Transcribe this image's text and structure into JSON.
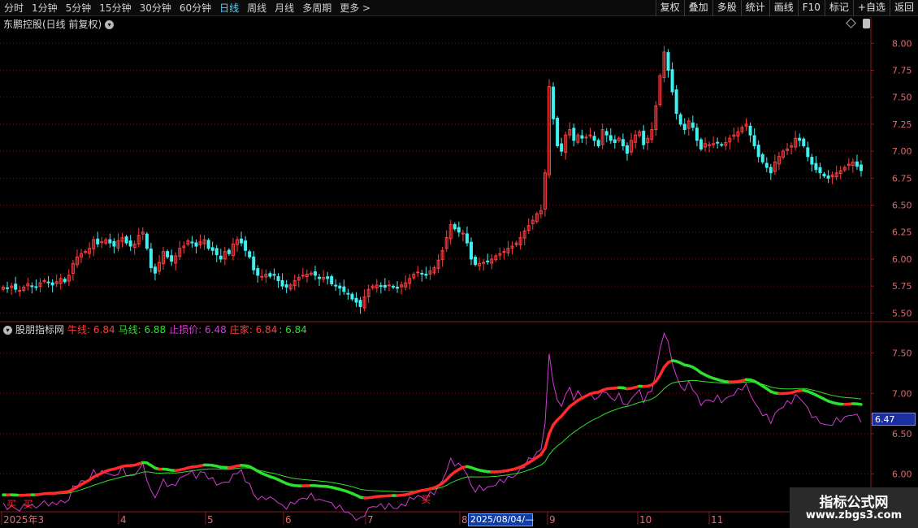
{
  "toolbar": {
    "periods": [
      "分时",
      "1分钟",
      "5分钟",
      "15分钟",
      "30分钟",
      "60分钟",
      "日线",
      "周线",
      "月线",
      "多周期",
      "更多 >"
    ],
    "active_period": "日线",
    "tools": [
      "复权",
      "叠加",
      "多股",
      "统计",
      "画线",
      "F10",
      "标记",
      "+自选",
      "返回"
    ]
  },
  "price_panel": {
    "title": "东鹏控股(日线 前复权)"
  },
  "indicator_panel": {
    "name": "股朋指标网",
    "bull_label": "牛线: 6.84",
    "horse_label": "马线: 6.88",
    "stop_label": "止损价: 6.48",
    "dealer_label": "庄家: 6.84",
    "dealer_extra": ": 6.84",
    "value_badge": "6.47",
    "marker_char": "买"
  },
  "x_axis": {
    "labels": [
      "2025年3",
      "4",
      "5",
      "6",
      "7",
      "8",
      "9",
      "10",
      "11"
    ],
    "cursor_date": "2025/08/04/—"
  },
  "watermark": {
    "title": "指标公式网",
    "url": "www.zbgs3.com"
  },
  "colors": {
    "up": "#ff3c3c",
    "down": "#3ef0f0",
    "bull_line": "#ff2a2a",
    "horse_line": "#2ee02e",
    "stop_line": "#d23cd2",
    "axis_text": "#e06a6a",
    "grid": "#6a1515"
  },
  "chart_data": [
    {
      "type": "candlestick",
      "title": "东鹏控股(日线 前复权)",
      "y_ticks": [
        5.5,
        5.75,
        6.0,
        6.25,
        6.5,
        6.75,
        7.0,
        7.25,
        7.5,
        7.75,
        8.0
      ],
      "ylim": [
        5.45,
        8.1
      ],
      "x_labels": [
        "2025年3",
        "4",
        "5",
        "6",
        "7",
        "8",
        "9",
        "10",
        "11"
      ],
      "closes": [
        5.74,
        5.73,
        5.75,
        5.72,
        5.71,
        5.74,
        5.77,
        5.75,
        5.74,
        5.78,
        5.8,
        5.78,
        5.76,
        5.79,
        5.82,
        5.79,
        5.85,
        5.96,
        6.02,
        6.05,
        6.07,
        6.1,
        6.18,
        6.14,
        6.16,
        6.18,
        6.15,
        6.12,
        6.17,
        6.2,
        6.15,
        6.12,
        6.14,
        6.22,
        6.25,
        6.1,
        5.92,
        5.87,
        5.97,
        6.07,
        6.02,
        5.98,
        6.03,
        6.1,
        6.12,
        6.17,
        6.15,
        6.12,
        6.16,
        6.18,
        6.1,
        6.08,
        6.04,
        6.0,
        6.07,
        6.05,
        6.14,
        6.18,
        6.15,
        6.08,
        6.02,
        5.9,
        5.85,
        5.84,
        5.86,
        5.84,
        5.85,
        5.8,
        5.75,
        5.74,
        5.76,
        5.8,
        5.83,
        5.85,
        5.86,
        5.87,
        5.85,
        5.82,
        5.83,
        5.82,
        5.77,
        5.75,
        5.73,
        5.7,
        5.68,
        5.63,
        5.6,
        5.56,
        5.65,
        5.72,
        5.75,
        5.76,
        5.75,
        5.74,
        5.76,
        5.74,
        5.73,
        5.76,
        5.78,
        5.82,
        5.86,
        5.88,
        5.86,
        5.85,
        5.89,
        5.92,
        5.99,
        6.08,
        6.2,
        6.32,
        6.28,
        6.25,
        6.24,
        6.15,
        6.0,
        5.95,
        5.96,
        5.97,
        5.98,
        6.0,
        6.03,
        6.05,
        6.07,
        6.1,
        6.12,
        6.15,
        6.2,
        6.26,
        6.31,
        6.36,
        6.42,
        6.45,
        6.8,
        7.6,
        7.3,
        7.05,
        7.0,
        7.15,
        7.2,
        7.1,
        7.15,
        7.12,
        7.13,
        7.15,
        7.1,
        7.05,
        7.2,
        7.15,
        7.1,
        7.08,
        7.12,
        7.05,
        6.98,
        7.1,
        7.15,
        7.18,
        7.06,
        7.12,
        7.2,
        7.42,
        7.7,
        7.92,
        7.75,
        7.55,
        7.35,
        7.25,
        7.2,
        7.28,
        7.22,
        7.1,
        7.02,
        7.07,
        7.06,
        7.07,
        7.08,
        7.06,
        7.08,
        7.12,
        7.15,
        7.18,
        7.22,
        7.25,
        7.15,
        7.05,
        6.95,
        6.9,
        6.85,
        6.8,
        6.9,
        6.95,
        7.0,
        7.02,
        7.05,
        7.12,
        7.1,
        7.05,
        6.95,
        6.88,
        6.83,
        6.8,
        6.77,
        6.75,
        6.78,
        6.8,
        6.82,
        6.85,
        6.88,
        6.9,
        6.86,
        6.82
      ],
      "up_color": "#ff3c3c",
      "down_color": "#3ef0f0",
      "grid": "dotted horizontal"
    },
    {
      "type": "line",
      "title": "股朋指标网",
      "y_ticks": [
        6.0,
        6.5,
        7.0,
        7.5
      ],
      "ylim": [
        5.55,
        7.85
      ],
      "x_labels": [
        "2025年3",
        "4",
        "5",
        "6",
        "7",
        "8",
        "9",
        "10",
        "11"
      ],
      "series": [
        {
          "name": "牛线",
          "color": "#ff2a2a",
          "last": 6.84
        },
        {
          "name": "马线",
          "color": "#2ee02e",
          "last": 6.88
        },
        {
          "name": "止损价",
          "color": "#d23cd2",
          "last": 6.48
        }
      ],
      "buy_marker": "买"
    }
  ]
}
